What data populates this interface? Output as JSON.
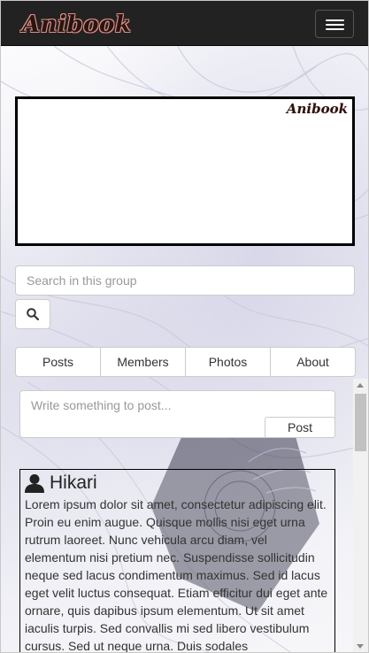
{
  "navbar": {
    "brand": "Anibook",
    "toggle_icon": "hamburger-menu-icon",
    "background": "#222222"
  },
  "cover": {
    "logo": "Anibook"
  },
  "search": {
    "placeholder": "Search in this group",
    "button_icon": "search-icon"
  },
  "tabs": [
    {
      "label": "Posts"
    },
    {
      "label": "Members"
    },
    {
      "label": "Photos"
    },
    {
      "label": "About"
    }
  ],
  "composer": {
    "placeholder": "Write something to post...",
    "post_label": "Post"
  },
  "post": {
    "author_icon": "user-icon",
    "author": "Hikari",
    "body": "Lorem ipsum dolor sit amet, consectetur adipiscing elit. Proin eu enim augue. Quisque mollis nisi eget urna rutrum laoreet. Nunc vehicula arcu diam, vel elementum nisi pretium nec. Suspendisse sollicitudin neque sed lacus condimentum maximus. Sed id lacus eget velit luctus consequat. Etiam efficitur dui eget ante ornare, quis dapibus ipsum elementum. Ut sit amet iaculis turpis. Sed convallis mi sed libero vestibulum cursus. Sed ut neque urna. Duis sodales"
  }
}
